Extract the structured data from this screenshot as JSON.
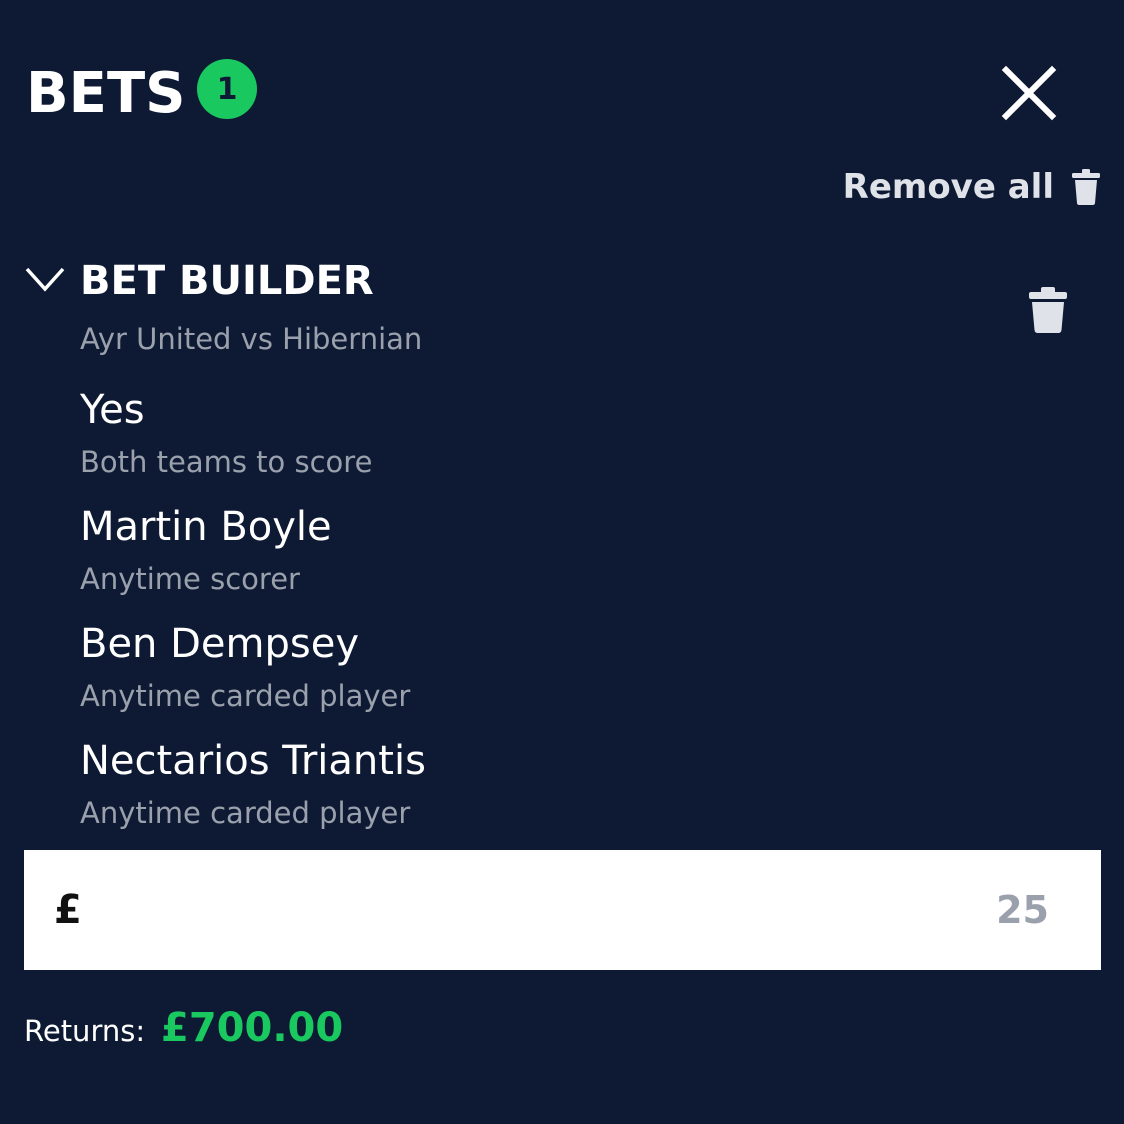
{
  "header": {
    "title": "BETS",
    "badge_count": "1",
    "close_icon": "close-icon"
  },
  "actions": {
    "remove_all_label": "Remove all",
    "remove_all_icon": "trash-icon"
  },
  "bet_builder": {
    "title": "BET BUILDER",
    "expand_icon": "chevron-down-icon",
    "match": "Ayr United vs Hibernian",
    "delete_icon": "trash-icon",
    "selections": [
      {
        "name": "Yes",
        "market": "Both teams to score"
      },
      {
        "name": "Martin Boyle",
        "market": "Anytime scorer"
      },
      {
        "name": "Ben Dempsey",
        "market": "Anytime carded player"
      },
      {
        "name": "Nectarios Triantis",
        "market": "Anytime carded player"
      }
    ]
  },
  "stake": {
    "currency": "£",
    "value": "25"
  },
  "returns": {
    "label": "Returns:",
    "value": "£700.00"
  },
  "colors": {
    "background": "#0e1a33",
    "accent_green": "#19c960",
    "muted_text": "#9aa1ad"
  }
}
